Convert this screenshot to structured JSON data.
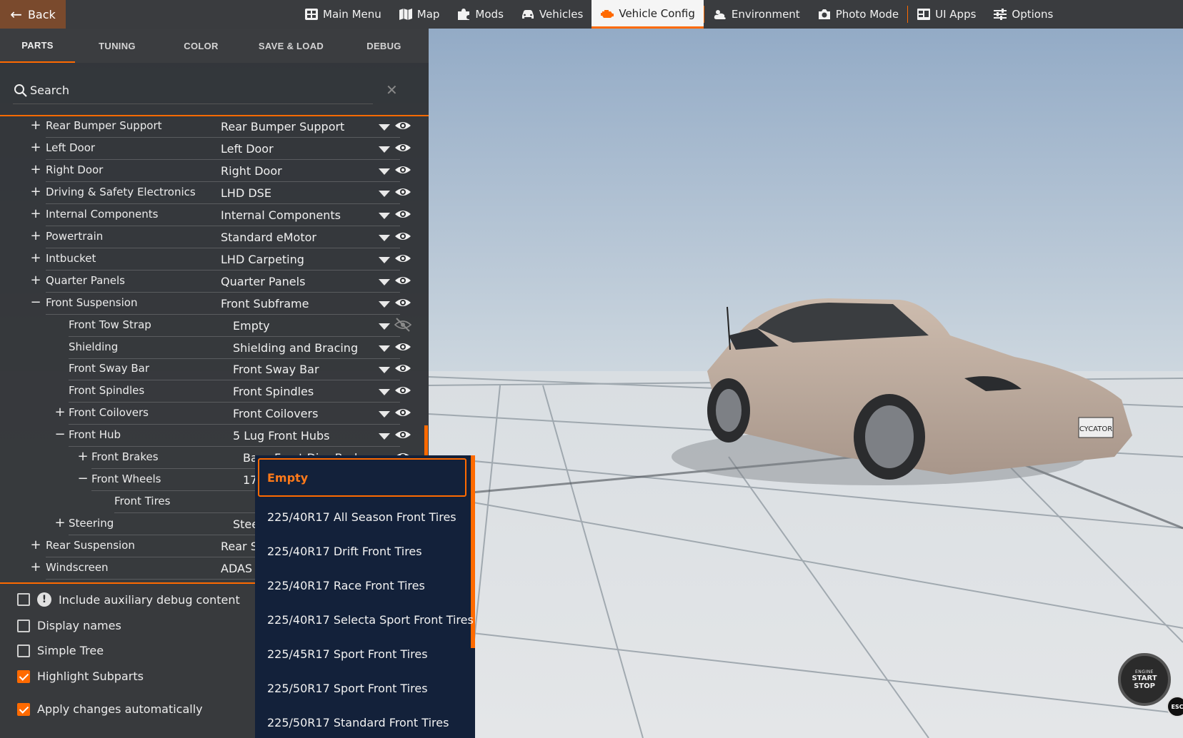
{
  "topbar": {
    "back_label": "Back",
    "menu": [
      {
        "label": "Main Menu",
        "icon": "grid-icon",
        "active": false
      },
      {
        "label": "Map",
        "icon": "map-icon",
        "active": false
      },
      {
        "label": "Mods",
        "icon": "puzzle-icon",
        "active": false
      },
      {
        "label": "Vehicles",
        "icon": "car-icon",
        "active": false
      },
      {
        "label": "Vehicle Config",
        "icon": "engine-icon",
        "active": true
      },
      {
        "label": "Environment",
        "icon": "weather-icon",
        "active": false
      },
      {
        "label": "Photo Mode",
        "icon": "camera-icon",
        "active": false
      },
      {
        "label": "UI Apps",
        "icon": "apps-icon",
        "active": false
      },
      {
        "label": "Options",
        "icon": "sliders-icon",
        "active": false
      }
    ],
    "accent_color": "#ff6a00"
  },
  "tabs": [
    {
      "label": "PARTS",
      "active": true
    },
    {
      "label": "TUNING",
      "active": false
    },
    {
      "label": "COLOR",
      "active": false
    },
    {
      "label": "SAVE & LOAD",
      "active": false
    },
    {
      "label": "DEBUG",
      "active": false
    }
  ],
  "search": {
    "placeholder": "Search",
    "value": ""
  },
  "tree": [
    {
      "name": "Rear Bumper Support",
      "value": "Rear Bumper Support",
      "toggle": "+",
      "level": 0,
      "visible": true
    },
    {
      "name": "Left Door",
      "value": "Left Door",
      "toggle": "+",
      "level": 0,
      "visible": true
    },
    {
      "name": "Right Door",
      "value": "Right Door",
      "toggle": "+",
      "level": 0,
      "visible": true
    },
    {
      "name": "Driving & Safety Electronics",
      "value": "LHD DSE",
      "toggle": "+",
      "level": 0,
      "visible": true
    },
    {
      "name": "Internal Components",
      "value": "Internal Components",
      "toggle": "+",
      "level": 0,
      "visible": true
    },
    {
      "name": "Powertrain",
      "value": "Standard eMotor",
      "toggle": "+",
      "level": 0,
      "visible": true
    },
    {
      "name": "Intbucket",
      "value": "LHD Carpeting",
      "toggle": "+",
      "level": 0,
      "visible": true
    },
    {
      "name": "Quarter Panels",
      "value": "Quarter Panels",
      "toggle": "+",
      "level": 0,
      "visible": true
    },
    {
      "name": "Front Suspension",
      "value": "Front Subframe",
      "toggle": "−",
      "level": 0,
      "visible": true
    },
    {
      "name": "Front Tow Strap",
      "value": "Empty",
      "toggle": "",
      "level": 1,
      "visible": false
    },
    {
      "name": "Shielding",
      "value": "Shielding and Bracing",
      "toggle": "",
      "level": 1,
      "visible": true
    },
    {
      "name": "Front Sway Bar",
      "value": "Front Sway Bar",
      "toggle": "",
      "level": 1,
      "visible": true
    },
    {
      "name": "Front Spindles",
      "value": "Front Spindles",
      "toggle": "",
      "level": 1,
      "visible": true
    },
    {
      "name": "Front Coilovers",
      "value": "Front Coilovers",
      "toggle": "+",
      "level": 1,
      "visible": true
    },
    {
      "name": "Front Hub",
      "value": "5 Lug Front Hubs",
      "toggle": "−",
      "level": 1,
      "visible": true
    },
    {
      "name": "Front Brakes",
      "value": "Base Front Disc Brakes",
      "toggle": "+",
      "level": 2,
      "visible": true
    },
    {
      "name": "Front Wheels",
      "value": "17",
      "toggle": "−",
      "level": 2,
      "visible": true
    },
    {
      "name": "Front Tires",
      "value": "",
      "toggle": "",
      "level": 3,
      "visible": true
    },
    {
      "name": "Steering",
      "value": "Stee",
      "toggle": "+",
      "level": 1,
      "visible": true
    },
    {
      "name": "Rear Suspension",
      "value": "Rear S",
      "toggle": "+",
      "level": 0,
      "visible": true
    },
    {
      "name": "Windscreen",
      "value": "ADAS V",
      "toggle": "+",
      "level": 0,
      "visible": true
    }
  ],
  "options": [
    {
      "label": "Include auxiliary debug content",
      "checked": false,
      "warning": true
    },
    {
      "label": "Display names",
      "checked": false,
      "warning": false
    },
    {
      "label": "Simple Tree",
      "checked": false,
      "warning": false
    },
    {
      "label": "Highlight Subparts",
      "checked": true,
      "warning": false
    },
    {
      "label": "Apply changes automatically",
      "checked": true,
      "warning": false
    }
  ],
  "dropdown": {
    "items": [
      {
        "label": "Empty",
        "active": true
      },
      {
        "label": "225/40R17 All Season Front Tires",
        "active": false
      },
      {
        "label": "225/40R17 Drift Front Tires",
        "active": false
      },
      {
        "label": "225/40R17 Race Front Tires",
        "active": false
      },
      {
        "label": "225/40R17 Selecta Sport Front Tires",
        "active": false
      },
      {
        "label": "225/45R17 Sport Front Tires",
        "active": false
      },
      {
        "label": "225/50R17 Sport Front Tires",
        "active": false
      },
      {
        "label": "225/50R17 Standard Front Tires",
        "active": false
      }
    ]
  },
  "engine_button": {
    "line1": "ENGINE",
    "line2": "START",
    "line3": "STOP"
  },
  "esc_label": "ESC",
  "license_plate": "CYCATOR"
}
